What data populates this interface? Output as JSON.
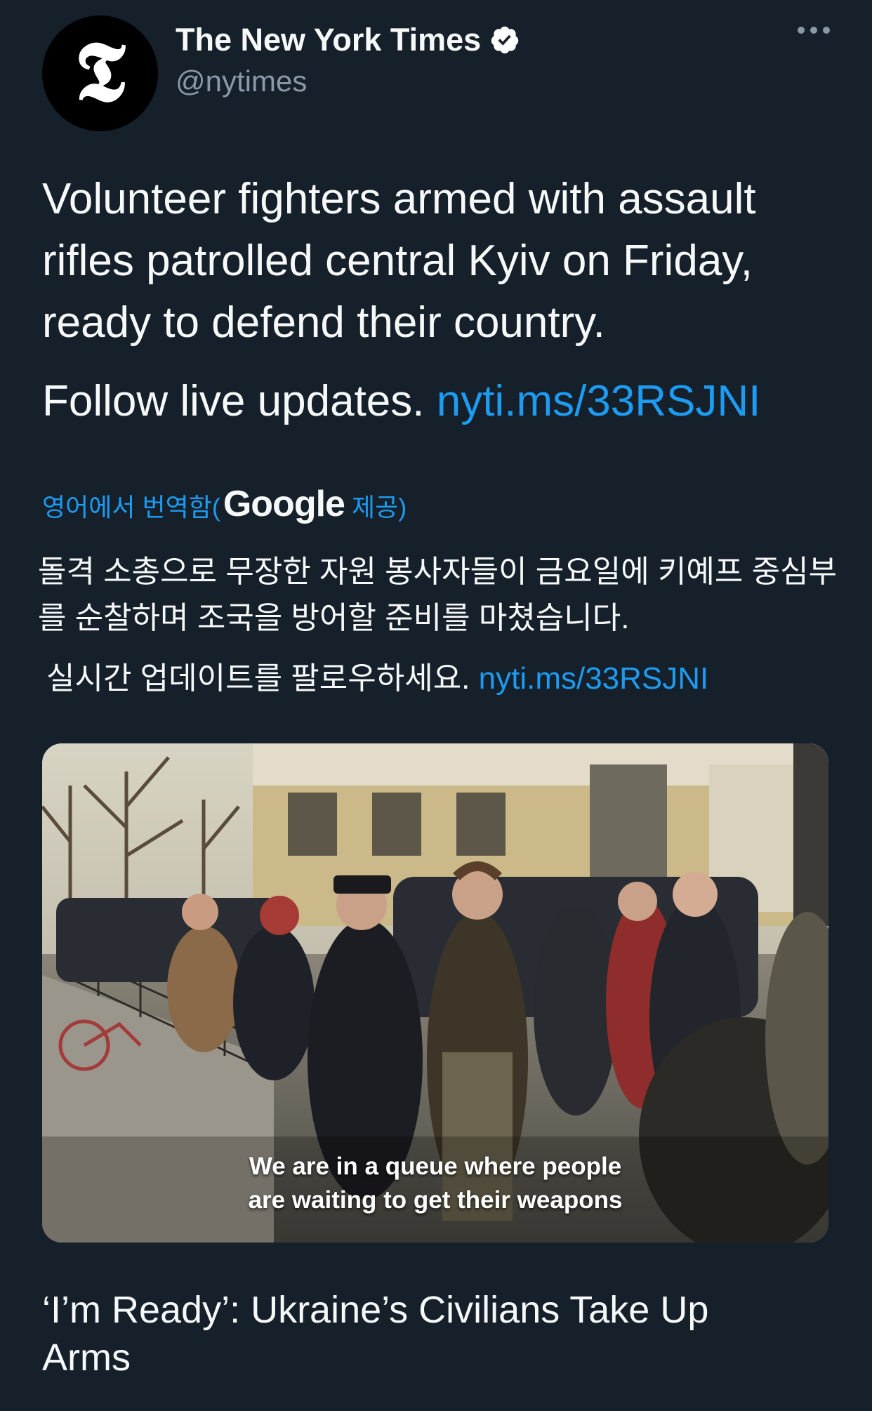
{
  "tweet": {
    "author_name": "The New York Times",
    "author_handle": "@nytimes",
    "avatar_glyph": "𝕿",
    "verified": true,
    "text": "Volunteer fighters armed with assault rifles patrolled central Kyiv on Friday, ready to defend their country.",
    "follow_text": "Follow live updates.",
    "link": "nyti.ms/33RSJNI"
  },
  "translation": {
    "prefix": "영어에서 번역함(",
    "google": "Google",
    "suffix": "제공)",
    "text": "돌격 소총으로 무장한 자원 봉사자들이 금요일에 키예프 중심부를 순찰하며 조국을 방어할 준비를 마쳤습니다.",
    "follow_text": "실시간 업데이트를 팔로우하세요.",
    "link": "nyti.ms/33RSJNI"
  },
  "media": {
    "caption_line1": "We are in a queue where people",
    "caption_line2": "are waiting to get their weapons"
  },
  "card": {
    "title": "‘I’m Ready’: Ukraine’s Civilians Take Up Arms"
  },
  "colors": {
    "background": "#15202b",
    "link": "#1d9bf0",
    "secondary_text": "#8b98a5",
    "verified_badge": "#ffffff"
  }
}
